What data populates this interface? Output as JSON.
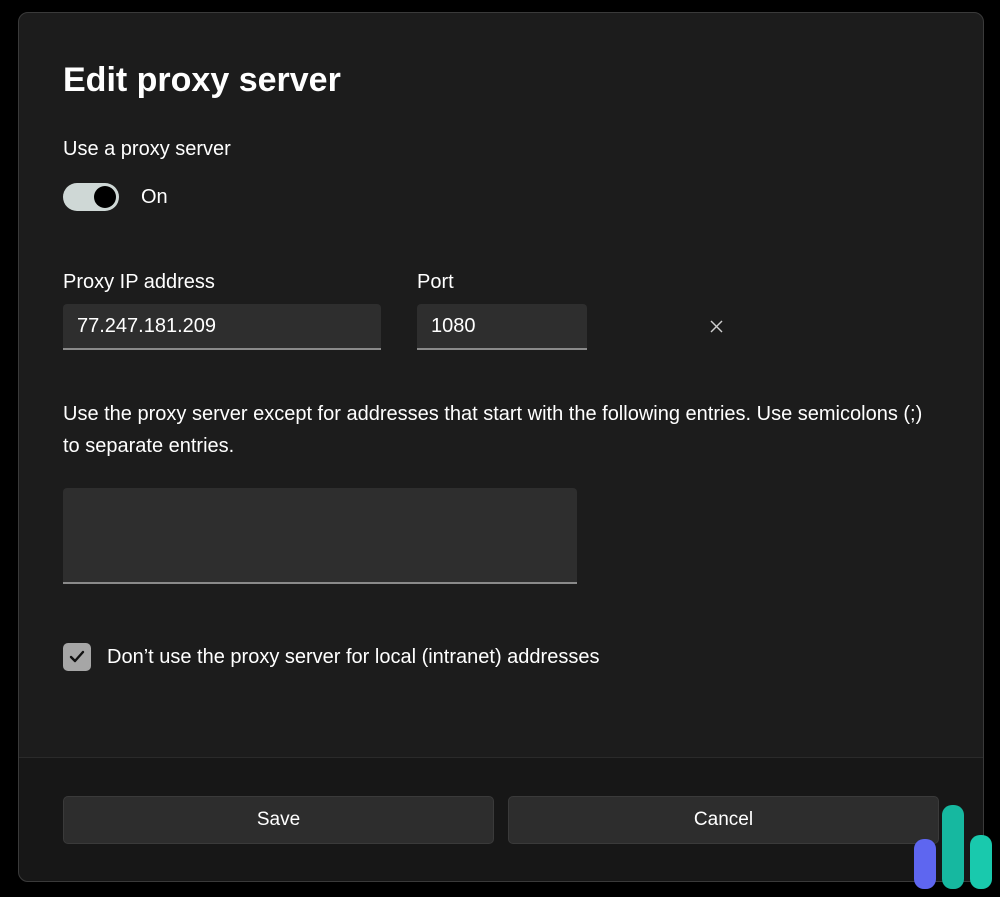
{
  "dialog": {
    "title": "Edit proxy server",
    "use_proxy_label": "Use a proxy server",
    "toggle_state_label": "On",
    "ip_label": "Proxy IP address",
    "ip_value": "77.247.181.209",
    "port_label": "Port",
    "port_value": "1080",
    "exceptions_text": "Use the proxy server except for addresses that start with the following entries. Use semicolons (;) to separate entries.",
    "exceptions_value": "",
    "checkbox_label": "Don’t use the proxy server for local (intranet) addresses",
    "checkbox_checked": true,
    "save_label": "Save",
    "cancel_label": "Cancel"
  }
}
